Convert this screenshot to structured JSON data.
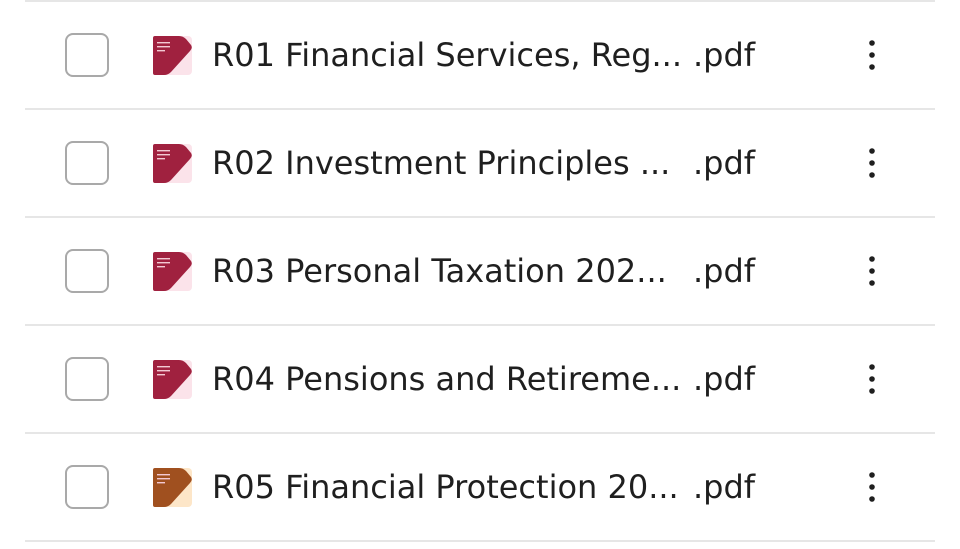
{
  "files": [
    {
      "name": "R01 Financial Services, Reg...",
      "ext": ".pdf",
      "thumb_bg": "#fbe3ea",
      "thumb_fg": "#a0213f",
      "thumb_icon": "pdf-cover-icon"
    },
    {
      "name": "R02 Investment Principles ...",
      "ext": ".pdf",
      "thumb_bg": "#fbe3ea",
      "thumb_fg": "#a0213f",
      "thumb_icon": "pdf-cover-icon"
    },
    {
      "name": "R03 Personal Taxation 202...",
      "ext": ".pdf",
      "thumb_bg": "#fbe3ea",
      "thumb_fg": "#a0213f",
      "thumb_icon": "pdf-cover-icon"
    },
    {
      "name": "R04 Pensions and Retireme...",
      "ext": ".pdf",
      "thumb_bg": "#fbe3ea",
      "thumb_fg": "#a0213f",
      "thumb_icon": "pdf-cover-icon"
    },
    {
      "name": "R05 Financial Protection 20...",
      "ext": ".pdf",
      "thumb_bg": "#fde6c8",
      "thumb_fg": "#a0501f",
      "thumb_icon": "pdf-cover-icon"
    }
  ],
  "more_icon": "more-vertical-icon",
  "colors": {
    "text": "#1f1f1f",
    "divider": "#e6e6e6",
    "checkbox_border": "#a9a9a9"
  }
}
